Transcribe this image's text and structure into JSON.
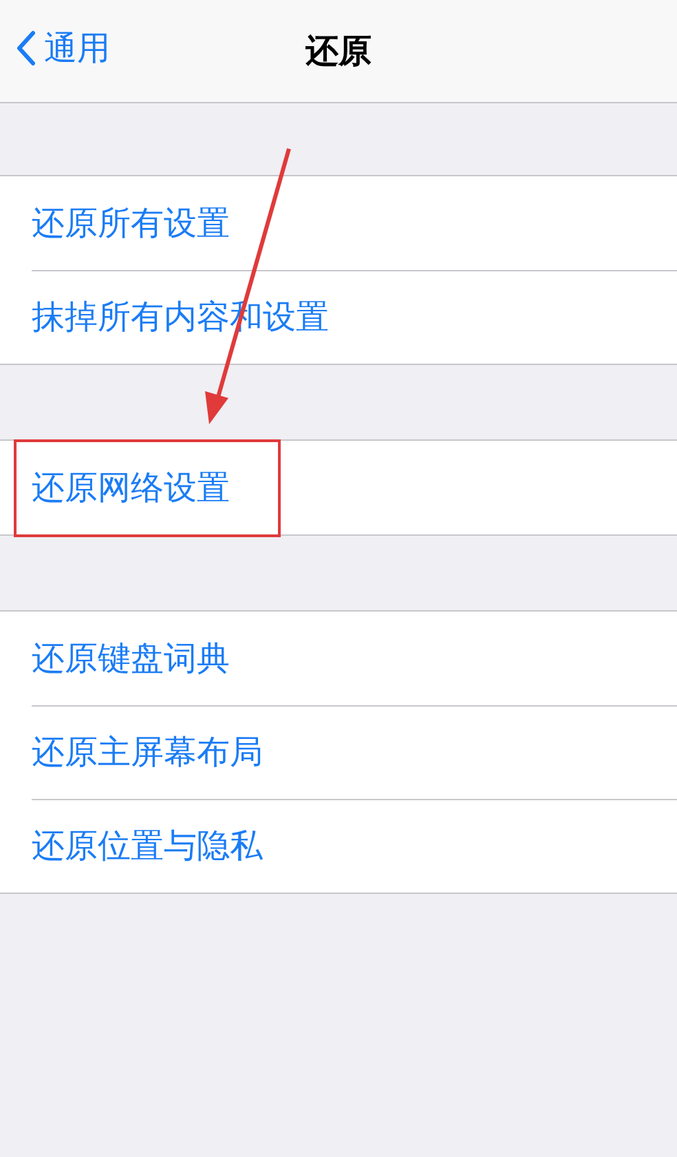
{
  "nav": {
    "back": "通用",
    "title": "还原"
  },
  "groups": [
    {
      "rows": [
        {
          "label": "还原所有设置",
          "highlighted": false
        },
        {
          "label": "抹掉所有内容和设置",
          "highlighted": false
        }
      ]
    },
    {
      "rows": [
        {
          "label": "还原网络设置",
          "highlighted": true
        }
      ]
    },
    {
      "rows": [
        {
          "label": "还原键盘词典",
          "highlighted": false
        },
        {
          "label": "还原主屏幕布局",
          "highlighted": false
        },
        {
          "label": "还原位置与隐私",
          "highlighted": false
        }
      ]
    }
  ]
}
